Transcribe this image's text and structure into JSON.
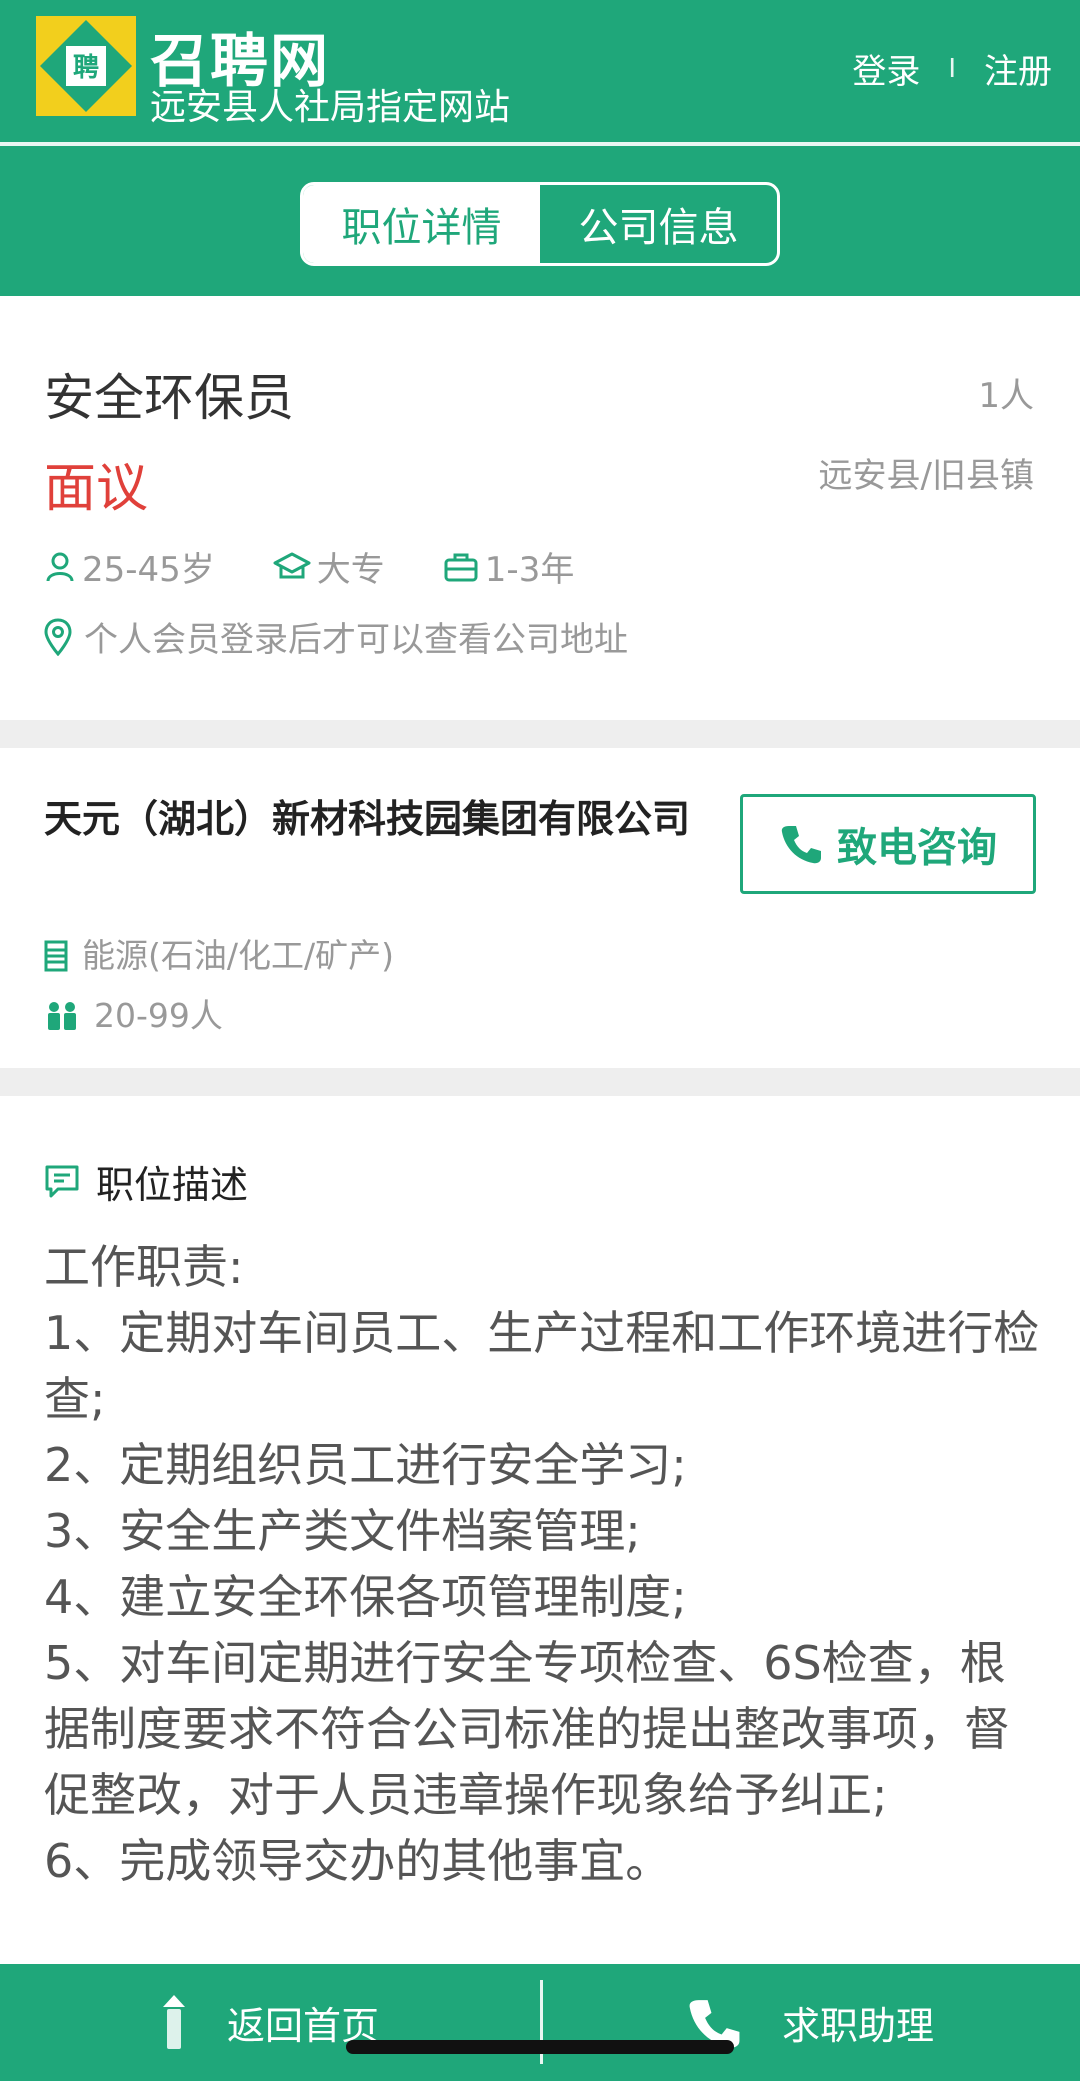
{
  "header": {
    "site_name": "召聘网",
    "site_subtitle": "远安县人社局指定网站",
    "login_label": "登录",
    "separator": "I",
    "register_label": "注册",
    "logo_text": "聘"
  },
  "tabs": [
    {
      "label": "职位详情",
      "active": true
    },
    {
      "label": "公司信息",
      "active": false
    }
  ],
  "job": {
    "title": "安全环保员",
    "headcount": "1人",
    "salary": "面议",
    "location": "远安县/旧县镇",
    "age": "25-45岁",
    "education": "大专",
    "experience": "1-3年",
    "address_notice": "个人会员登录后才可以查看公司地址"
  },
  "company": {
    "name": "天元（湖北）新材科技园集团有限公司",
    "call_label": "致电咨询",
    "industry": "能源(石油/化工/矿产)",
    "size": "20-99人"
  },
  "description": {
    "heading": "职位描述",
    "lines": [
      "工作职责:",
      "1、定期对车间员工、生产过程和工作环境进行检查;",
      "2、定期组织员工进行安全学习;",
      "3、安全生产类文件档案管理;",
      "4、建立安全环保各项管理制度;",
      "5、对车间定期进行安全专项检查、6S检查，根据制度要求不符合公司标准的提出整改事项，督促整改，对于人员违章操作现象给予纠正;",
      "6、完成领导交办的其他事宜。"
    ]
  },
  "bottom_bar": {
    "home_label": "返回首页",
    "assistant_label": "求职助理"
  },
  "colors": {
    "brand": "#1fa77a",
    "salary": "#e0403a",
    "muted": "#999999"
  }
}
